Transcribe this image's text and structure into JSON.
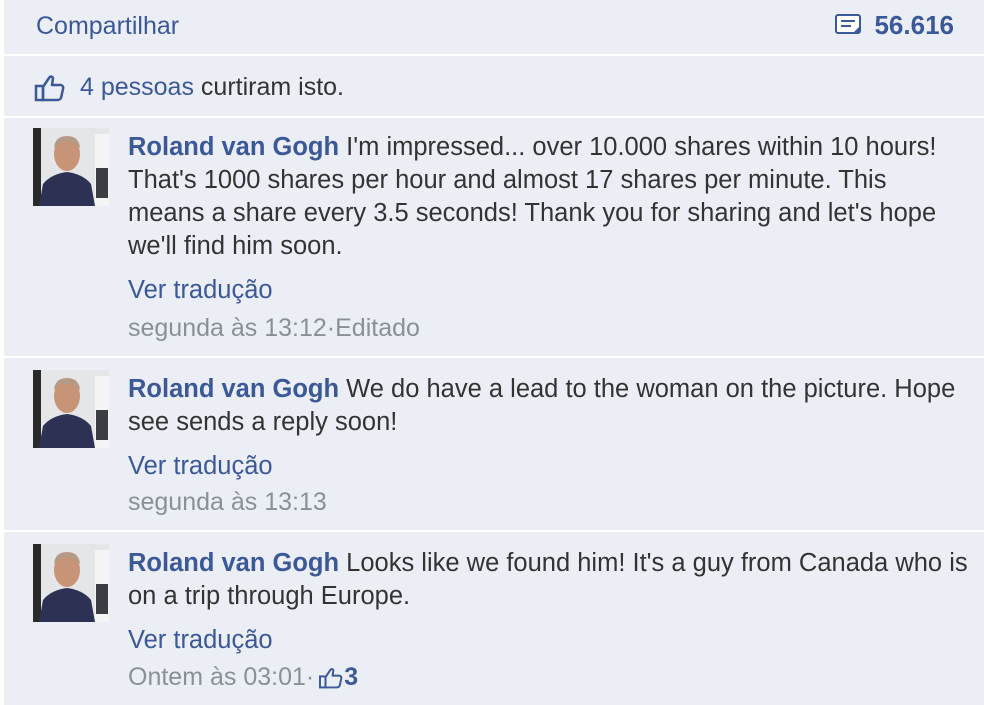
{
  "share": {
    "label": "Compartilhar",
    "count": "56.616"
  },
  "likes": {
    "people": "4 pessoas",
    "text": " curtiram isto."
  },
  "comments": [
    {
      "author": "Roland van Gogh",
      "text": " I'm impressed... over 10.000 shares within 10 hours! That's 1000 shares per hour and almost 17 shares per minute. This means a share every 3.5 seconds! Thank you for sharing and let's hope we'll find him soon.",
      "translate": "Ver tradução",
      "time": "segunda às 13:12",
      "sep": " · ",
      "edited": "Editado"
    },
    {
      "author": "Roland van Gogh",
      "text": " We do have a lead to the woman on the picture. Hope see sends a reply soon!",
      "translate": "Ver tradução",
      "time": "segunda às 13:13"
    },
    {
      "author": "Roland van Gogh",
      "text": " Looks like we found him! It's a guy from Canada who is on a trip through Europe.",
      "translate": "Ver tradução",
      "time": "Ontem às 03:01",
      "sep": " · ",
      "like_count": "3"
    }
  ],
  "icons": {
    "share_count": "comment-bubble-icon",
    "like": "thumbs-up-icon"
  },
  "colors": {
    "link": "#3b5998",
    "background": "#eceef5",
    "meta": "#8a8f98"
  }
}
